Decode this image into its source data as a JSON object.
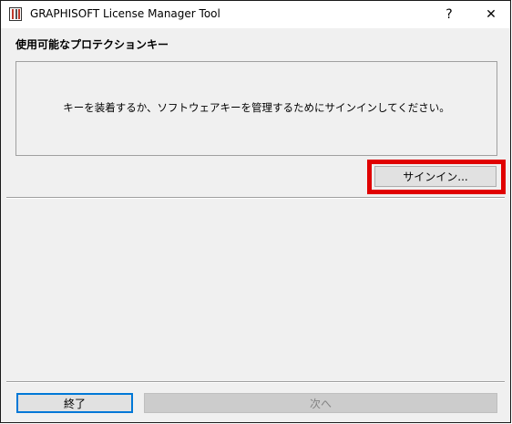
{
  "window": {
    "title": "GRAPHISOFT License Manager Tool",
    "help_glyph": "?",
    "close_glyph": "✕",
    "icon": "graphisoft-app-icon"
  },
  "protection_keys": {
    "heading": "使用可能なプロテクションキー",
    "message": "キーを装着するか、ソフトウェアキーを管理するためにサインインしてください。"
  },
  "buttons": {
    "sign_in": "サインイン...",
    "exit": "終了",
    "next": "次へ"
  },
  "colors": {
    "highlight": "#e00000",
    "focus": "#0078d7"
  }
}
